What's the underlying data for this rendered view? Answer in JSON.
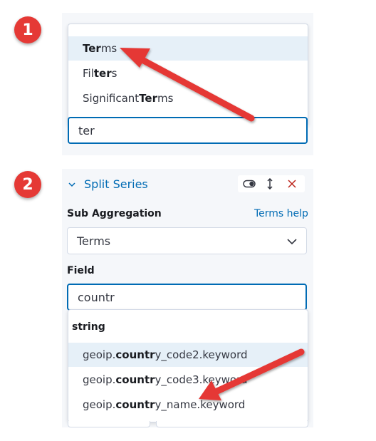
{
  "step1": {
    "badge": "1",
    "options": [
      {
        "match": "Ter",
        "rest": "ms",
        "highlighted": true
      },
      {
        "pre": "Fil",
        "match": "ter",
        "rest": "s"
      },
      {
        "pre": "Significant ",
        "match": "Ter",
        "rest": "ms"
      }
    ],
    "search_value": "ter"
  },
  "step2": {
    "badge": "2",
    "header_title": "Split Series",
    "sub_aggregation_label": "Sub Aggregation",
    "help_link": "Terms help",
    "select_value": "Terms",
    "field_label": "Field",
    "field_value": "countr",
    "group_label": "string",
    "options": [
      {
        "pre": "geoip.",
        "match": "countr",
        "rest": "y_code2.keyword",
        "highlighted": true
      },
      {
        "pre": "geoip.",
        "match": "countr",
        "rest": "y_code3.keyword"
      },
      {
        "pre": "geoip.",
        "match": "countr",
        "rest": "y_name.keyword"
      }
    ]
  },
  "colors": {
    "accent": "#006bb4",
    "badge": "#e53935",
    "arrow": "#e53935",
    "danger": "#bd271e"
  },
  "icons": [
    "chevron-down-icon",
    "toggle-icon",
    "sort-icon",
    "close-icon",
    "arrow-annotation"
  ]
}
